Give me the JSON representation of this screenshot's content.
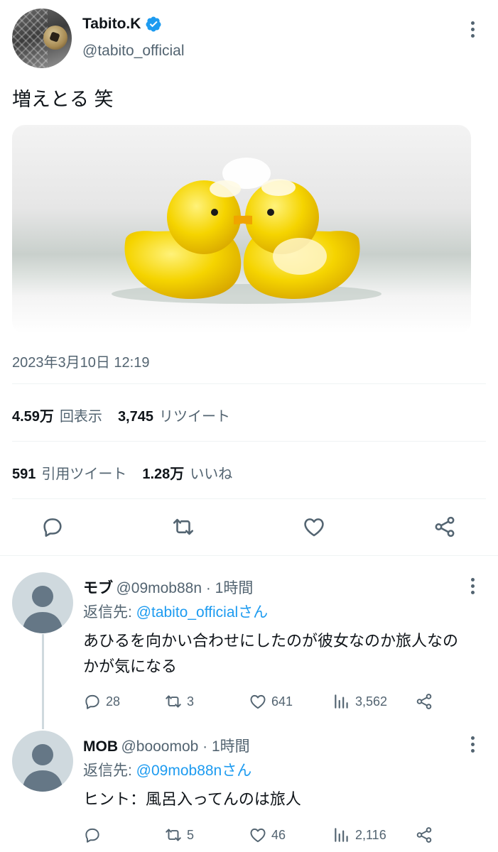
{
  "tweet": {
    "author_name": "Tabito.K",
    "author_handle": "@tabito_official",
    "text": "増えとる 笑",
    "timestamp": "2023年3月10日 12:19",
    "stats": {
      "views_count": "4.59万",
      "views_label": "回表示",
      "retweets_count": "3,745",
      "retweets_label": "リツイート",
      "quotes_count": "591",
      "quotes_label": "引用ツイート",
      "likes_count": "1.28万",
      "likes_label": "いいね"
    }
  },
  "replies": [
    {
      "name": "モブ",
      "meta": "@09mob88n · 1時間",
      "reply_prefix": "返信先: ",
      "reply_to": "@tabito_officialさん",
      "text_line1": "あひるを向かい合わせにしたのが彼女なのか旅人なの",
      "text_line2": "かが気になる",
      "reply_count": "28",
      "retweet_count": "3",
      "like_count": "641",
      "views_count": "3,562"
    },
    {
      "name": "MOB",
      "meta": "@booomob · 1時間",
      "reply_prefix": "返信先: ",
      "reply_to": "@09mob88nさん",
      "text_line1": "ヒント：風呂入ってんのは旅人",
      "reply_count": "",
      "retweet_count": "5",
      "like_count": "46",
      "views_count": "2,116"
    }
  ],
  "colors": {
    "accent": "#1d9bf0",
    "secondary_text": "#536471",
    "duck_yellow": "#f5d400"
  }
}
